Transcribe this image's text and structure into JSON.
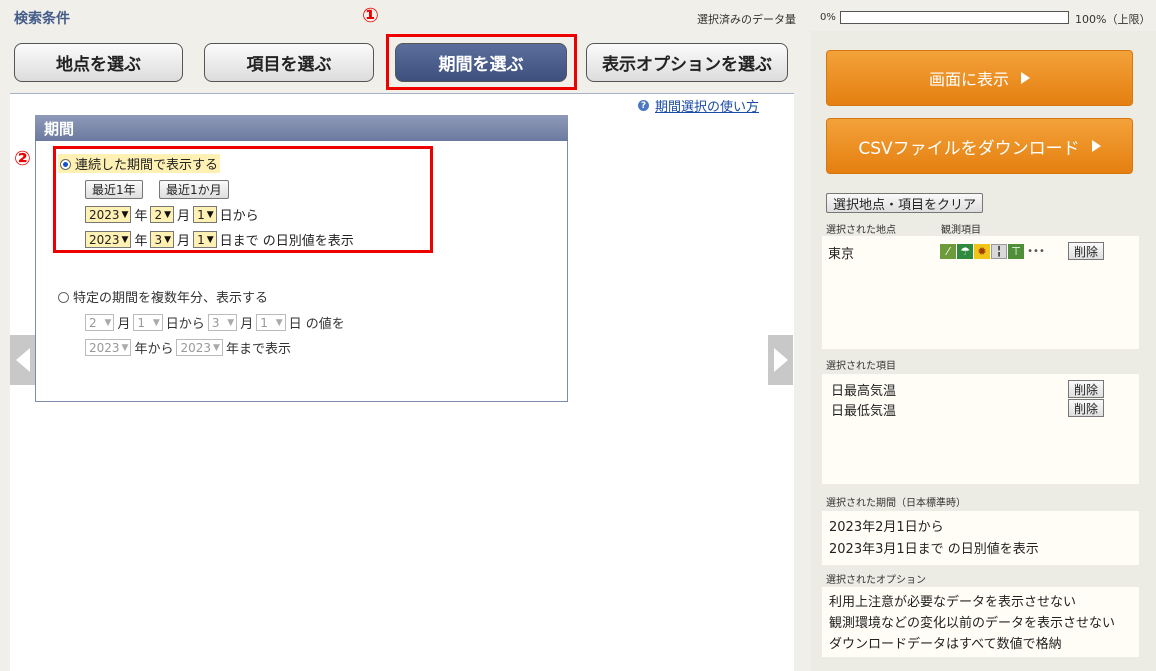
{
  "header": {
    "title": "検索条件",
    "progress_label": "選択済みのデータ量",
    "progress_min": "0%",
    "progress_max": "100%（上限）",
    "progress_fraction": 0.0
  },
  "markers": {
    "m1": "①",
    "m2": "②"
  },
  "tabs": [
    {
      "label": "地点を選ぶ",
      "active": false
    },
    {
      "label": "項目を選ぶ",
      "active": false
    },
    {
      "label": "期間を選ぶ",
      "active": true
    },
    {
      "label": "表示オプションを選ぶ",
      "active": false
    }
  ],
  "help": {
    "icon": "question-circle-icon",
    "link": "期間選択の使い方"
  },
  "period": {
    "header": "期間",
    "continuous": {
      "label": "連続した期間で表示する",
      "selected": true,
      "quick_buttons": [
        "最近1年",
        "最近1か月"
      ],
      "from": {
        "year": "2023",
        "month": "2",
        "day": "1",
        "suffix": "日から"
      },
      "to": {
        "year": "2023",
        "month": "3",
        "day": "1",
        "suffix": "日まで の日別値を表示"
      }
    },
    "specific": {
      "label": "特定の期間を複数年分、表示する",
      "selected": false,
      "from_month": "2",
      "from_day": "1",
      "from_suffix": "日から",
      "to_month": "3",
      "to_day": "1",
      "to_suffix": "日 の値を",
      "year_from": "2023",
      "year_from_suffix": "年から",
      "year_to": "2023",
      "year_to_suffix": "年まで表示"
    },
    "units": {
      "year": "年",
      "month": "月"
    }
  },
  "sidebar": {
    "display_button": "画面に表示",
    "csv_button": "CSVファイルをダウンロード",
    "clear_button": "選択地点・項目をクリア",
    "points_label": "選択された地点",
    "elements_label": "観測項目",
    "points": [
      {
        "name": "東京",
        "delete": "削除"
      }
    ],
    "element_icons": [
      "rain-icon",
      "umbrella-icon",
      "sun-icon",
      "thermometer-icon",
      "wind-icon"
    ],
    "more_icon": "•••",
    "items_label": "選択された項目",
    "items": [
      {
        "name": "日最高気温",
        "delete": "削除"
      },
      {
        "name": "日最低気温",
        "delete": "削除"
      }
    ],
    "period_label": "選択された期間（日本標準時）",
    "period_lines": [
      "2023年2月1日から",
      "2023年3月1日まで の日別値を表示"
    ],
    "options_label": "選択されたオプション",
    "options": [
      "利用上注意が必要なデータを表示させない",
      "観測環境などの変化以前のデータを表示させない",
      "ダウンロードデータはすべて数値で格納"
    ]
  },
  "colors": {
    "accent": "#3d4f7c",
    "highlight": "#e00000",
    "orange": "#e98a1c"
  }
}
